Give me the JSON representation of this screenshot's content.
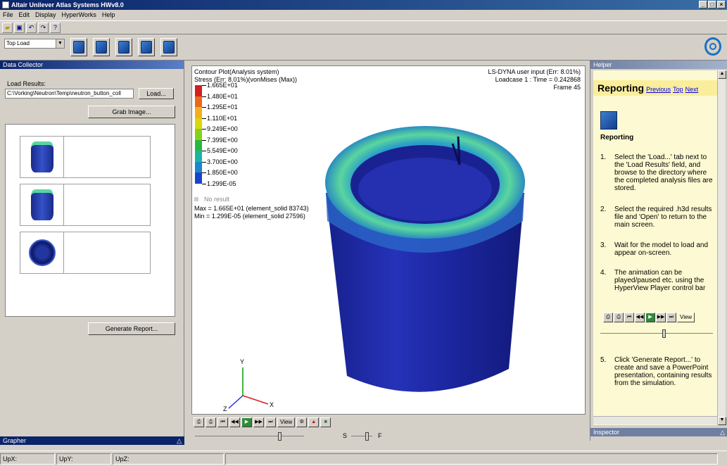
{
  "window": {
    "title": "Altair Unilever Atlas Systems HWv8.0"
  },
  "menu": [
    "File",
    "Edit",
    "Display",
    "HyperWorks",
    "Help"
  ],
  "toolbar": {
    "load_case": "Top Load"
  },
  "left_panel": {
    "title": "Data Collector",
    "load_results_label": "Load Results:",
    "load_results_value": "C:\\Vorking\\Neutron\\Temp\\neutron_button_coll",
    "load_button": "Load...",
    "grab_button": "Grab Image...",
    "generate_button": "Generate Report..."
  },
  "grapher": {
    "title": "Grapher"
  },
  "viewport": {
    "plot_title": "Contour Plot(Analysis system)",
    "plot_subtitle": "Stress (Err: 8.01%)(vonMises (Max))",
    "source": "LS-DYNA user input (Err: 8.01%)",
    "loadcase": "Loadcase 1 : Time = 0.242868",
    "frame": "Frame 45",
    "legend_values": [
      "1.665E+01",
      "1.480E+01",
      "1.295E+01",
      "1.110E+01",
      "9.249E+00",
      "7.399E+00",
      "5.549E+00",
      "3.700E+00",
      "1.850E+00",
      "1.299E-05"
    ],
    "legend_colors": [
      "#d42020",
      "#e86a1a",
      "#f4b01c",
      "#d8d80a",
      "#86d01a",
      "#2ab83c",
      "#1ab5a2",
      "#1a86d0",
      "#1a44c8",
      "#1a18a0"
    ],
    "no_result": "No result",
    "max_text": "Max = 1.665E+01 (element_solid 83743)",
    "min_text": "Min = 1.299E-05 (element_solid 27596)",
    "axis_y": "Y",
    "axis_x": "X",
    "axis_z": "Z"
  },
  "controls": {
    "view": "View",
    "slow": "S",
    "fast": "F"
  },
  "helper": {
    "title": "Helper",
    "heading": "Reporting",
    "prev": "Previous",
    "top": "Top",
    "next": "Next",
    "section": "Reporting",
    "steps": [
      {
        "n": "1.",
        "text": "Select the 'Load...' tab next to the 'Load Results' field, and browse to the directory where the completed analysis files are stored."
      },
      {
        "n": "2.",
        "text": "Select the required .h3d results file and 'Open' to return to the main screen."
      },
      {
        "n": "3.",
        "text": "Wait for the model to load and appear on-screen."
      },
      {
        "n": "4.",
        "text": "The animation can be played/paused etc. using the HyperView Player control bar"
      },
      {
        "n": "5.",
        "text": "Click 'Generate Report...' to create and save a PowerPoint presentation, containing results from the simulation."
      }
    ],
    "view": "View"
  },
  "inspector": {
    "title": "Inspector"
  },
  "status": {
    "upx": "UpX:",
    "upy": "UpY:",
    "upz": "UpZ:"
  }
}
